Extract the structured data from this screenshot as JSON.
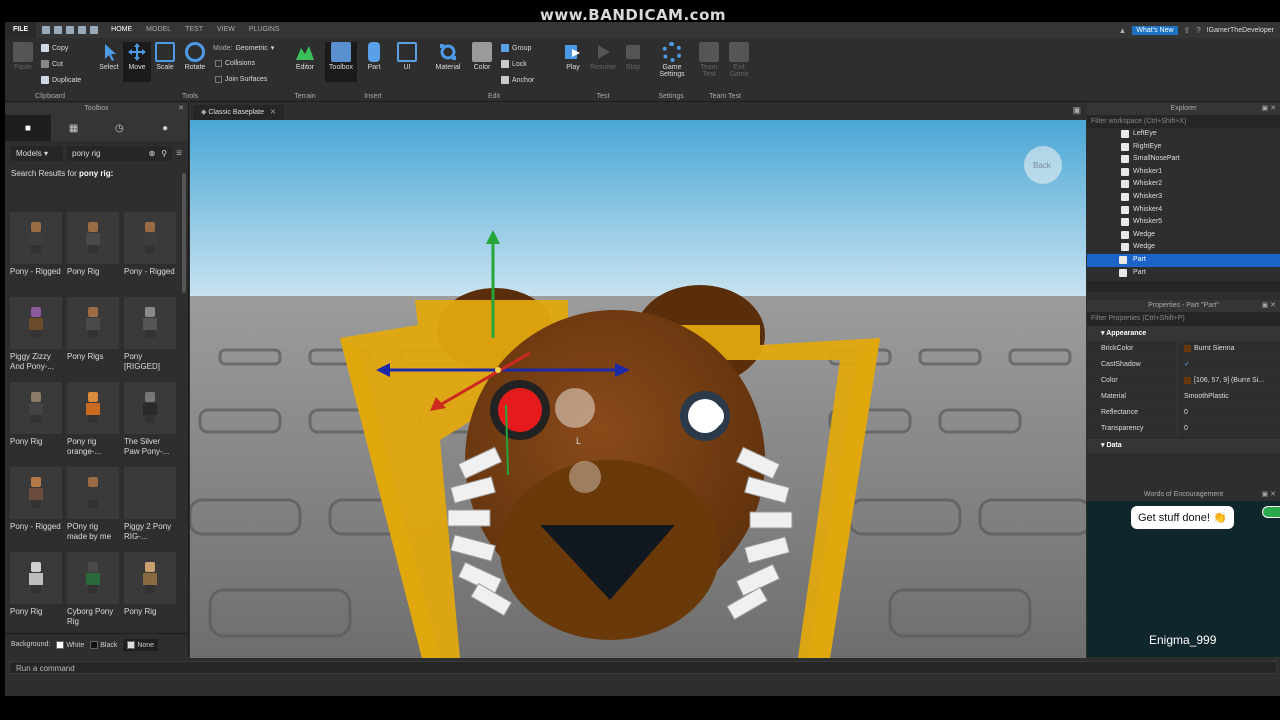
{
  "watermark": "www.BANDICAM.com",
  "menubar": {
    "file": "FILE",
    "tabs": [
      "HOME",
      "MODEL",
      "TEST",
      "VIEW",
      "PLUGINS"
    ],
    "whats_new": "What's New",
    "username": "IGamerTheDeveloper"
  },
  "ribbon": {
    "clipboard": {
      "paste": "Paste",
      "copy": "Copy",
      "cut": "Cut",
      "duplicate": "Duplicate",
      "label": "Clipboard"
    },
    "tools": {
      "select": "Select",
      "move": "Move",
      "scale": "Scale",
      "rotate": "Rotate",
      "mode_label": "Mode:",
      "mode_value": "Geometric",
      "collisions": "Collisions",
      "join_surfaces": "Join Surfaces",
      "label": "Tools"
    },
    "terrain": {
      "editor": "Editor",
      "label": "Terrain"
    },
    "insert": {
      "toolbox": "Toolbox",
      "part": "Part",
      "ui": "UI",
      "label": "Insert"
    },
    "edit": {
      "material": "Material",
      "color": "Color",
      "group": "Group",
      "lock": "Lock",
      "anchor": "Anchor",
      "label": "Edit"
    },
    "test": {
      "play": "Play",
      "resume": "Resume",
      "stop": "Stop",
      "label": "Test"
    },
    "settings": {
      "game_settings": "Game Settings",
      "label": "Settings"
    },
    "team_test": {
      "team_test": "Team Test",
      "exit_game": "Exit Game",
      "label": "Team Test"
    }
  },
  "toolbox": {
    "title": "Toolbox",
    "category": "Models",
    "search_value": "pony rig",
    "results_prefix": "Search Results for",
    "results_query": "pony rig:",
    "items": [
      {
        "name": "Pony - Rigged",
        "head": "#9b6b44",
        "body": "#3d3d3d"
      },
      {
        "name": "Pony Rig",
        "head": "#9b6b44",
        "body": "#4a4a4a"
      },
      {
        "name": "Pony - Rigged",
        "head": "#9b6b44",
        "body": "#3d3d3d"
      },
      {
        "name": "Piggy Zizzy And Pony-...",
        "head": "#8a5a9b",
        "body": "#6a4a2a"
      },
      {
        "name": "Pony Rigs",
        "head": "#9b6b44",
        "body": "#4a4a4a"
      },
      {
        "name": "Pony [RIGGED]",
        "head": "#8a8a8a",
        "body": "#555555"
      },
      {
        "name": "Pony Rig",
        "head": "#8a7a66",
        "body": "#444444"
      },
      {
        "name": "Pony rig orange-...",
        "head": "#d98a3a",
        "body": "#c86a20"
      },
      {
        "name": "The Silver Paw Pony-...",
        "head": "#777777",
        "body": "#2a2a2a"
      },
      {
        "name": "Pony - Rigged",
        "head": "#b57a4a",
        "body": "#6a4a3a"
      },
      {
        "name": "POny rig made by me",
        "head": "#9b6b44",
        "body": "#3a3a3a"
      },
      {
        "name": "Piggy 2 Pony RIG-...",
        "head": "#3a3a3a",
        "body": "#3a3a3a"
      },
      {
        "name": "Pony Rig",
        "head": "#cfcfcf",
        "body": "#bdbdbd"
      },
      {
        "name": "Cyborg Pony Rig",
        "head": "#4a4a4a",
        "body": "#2a6a3a"
      },
      {
        "name": "Pony Rig",
        "head": "#c9a070",
        "body": "#8a6a40"
      }
    ],
    "background_label": "Background:",
    "bg_white": "White",
    "bg_black": "Black",
    "bg_none": "None"
  },
  "viewport": {
    "tab": "Classic Baseplate",
    "back_label": "Back",
    "cursor_label": "L"
  },
  "explorer": {
    "title": "Explorer",
    "filter_placeholder": "Filter workspace (Ctrl+Shift+X)",
    "items": [
      "LeftEye",
      "RightEye",
      "SmallNosePart",
      "Whisker1",
      "Whisker2",
      "Whisker3",
      "Whisker4",
      "Whisker5",
      "Wedge",
      "Wedge"
    ],
    "part_selected": "Part",
    "part_other": "Part"
  },
  "properties": {
    "title": "Properties - Part \"Part\"",
    "filter_placeholder": "Filter Properties (Ctrl+Shift+P)",
    "group_appearance": "Appearance",
    "rows": [
      {
        "key": "BrickColor",
        "value": "Burnt Sienna"
      },
      {
        "key": "CastShadow",
        "value": "✓"
      },
      {
        "key": "Color",
        "value": "[106, 57, 9] (Burnt Si..."
      },
      {
        "key": "Material",
        "value": "SmoothPlastic"
      },
      {
        "key": "Reflectance",
        "value": "0"
      },
      {
        "key": "Transparency",
        "value": "0"
      }
    ],
    "group_data": "Data"
  },
  "encouragement": {
    "title": "Words of Encouragement",
    "message": "Get stuff done! 👏",
    "user": "Enigma_999"
  },
  "command": {
    "placeholder": "Run a command"
  },
  "colors": {
    "accent": "#1d64c8",
    "bear": "#6a3909",
    "frame": "#e1a80e"
  }
}
